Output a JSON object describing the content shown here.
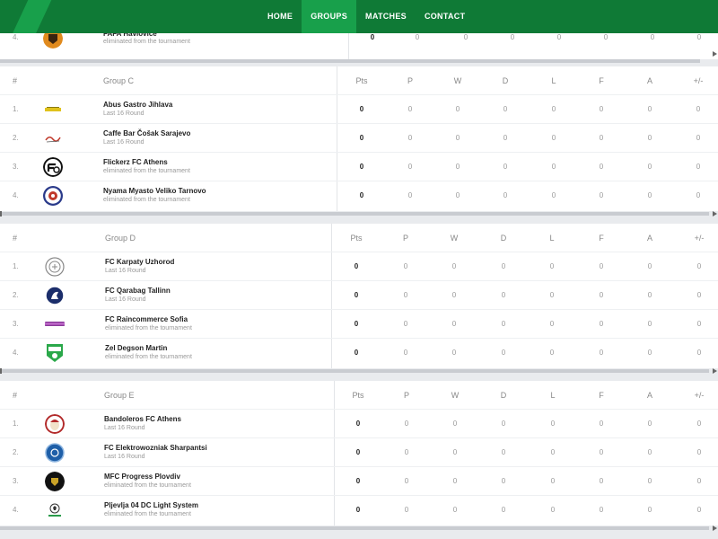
{
  "nav": {
    "home": "HOME",
    "groups": "GROUPS",
    "matches": "MATCHES",
    "contact": "CONTACT"
  },
  "columns": {
    "hash": "#",
    "pts": "Pts",
    "p": "P",
    "w": "W",
    "d": "D",
    "l": "L",
    "f": "F",
    "a": "A",
    "diff": "+/-"
  },
  "group_b_tail": {
    "rank": "4.",
    "name": "FAFA Havlovice",
    "status": "eliminated from the tournament",
    "pts": "0",
    "p": "0",
    "w": "0",
    "d": "0",
    "l": "0",
    "f": "0",
    "a": "0",
    "diff": "0",
    "logo": "shield-badge-icon"
  },
  "groups": [
    {
      "title": "Group C",
      "teams": [
        {
          "rank": "1.",
          "name": "Abus Gastro Jihlava",
          "status": "Last 16 Round",
          "pts": "0",
          "p": "0",
          "w": "0",
          "d": "0",
          "l": "0",
          "f": "0",
          "a": "0",
          "diff": "0",
          "logo": "text-logo-icon"
        },
        {
          "rank": "2.",
          "name": "Caffe Bar Čošak Sarajevo",
          "status": "Last 16 Round",
          "pts": "0",
          "p": "0",
          "w": "0",
          "d": "0",
          "l": "0",
          "f": "0",
          "a": "0",
          "diff": "0",
          "logo": "script-logo-icon"
        },
        {
          "rank": "3.",
          "name": "Flickerz FC Athens",
          "status": "eliminated from the tournament",
          "pts": "0",
          "p": "0",
          "w": "0",
          "d": "0",
          "l": "0",
          "f": "0",
          "a": "0",
          "diff": "0",
          "logo": "fc-ball-icon"
        },
        {
          "rank": "4.",
          "name": "Nyama Myasto Veliko Tarnovo",
          "status": "eliminated from the tournament",
          "pts": "0",
          "p": "0",
          "w": "0",
          "d": "0",
          "l": "0",
          "f": "0",
          "a": "0",
          "diff": "0",
          "logo": "round-crest-icon"
        }
      ]
    },
    {
      "title": "Group D",
      "teams": [
        {
          "rank": "1.",
          "name": "FC Karpaty Uzhorod",
          "status": "Last 16 Round",
          "pts": "0",
          "p": "0",
          "w": "0",
          "d": "0",
          "l": "0",
          "f": "0",
          "a": "0",
          "diff": "0",
          "logo": "outline-crest-icon"
        },
        {
          "rank": "2.",
          "name": "FC Qarabag Tallinn",
          "status": "Last 16 Round",
          "pts": "0",
          "p": "0",
          "w": "0",
          "d": "0",
          "l": "0",
          "f": "0",
          "a": "0",
          "diff": "0",
          "logo": "horse-crest-icon"
        },
        {
          "rank": "3.",
          "name": "FC Raincommerce Sofia",
          "status": "eliminated from the tournament",
          "pts": "0",
          "p": "0",
          "w": "0",
          "d": "0",
          "l": "0",
          "f": "0",
          "a": "0",
          "diff": "0",
          "logo": "banner-logo-icon"
        },
        {
          "rank": "4.",
          "name": "Zel Degson Martin",
          "status": "eliminated from the tournament",
          "pts": "0",
          "p": "0",
          "w": "0",
          "d": "0",
          "l": "0",
          "f": "0",
          "a": "0",
          "diff": "0",
          "logo": "zel-shield-icon"
        }
      ]
    },
    {
      "title": "Group E",
      "teams": [
        {
          "rank": "1.",
          "name": "Bandoleros FC Athens",
          "status": "Last 16 Round",
          "pts": "0",
          "p": "0",
          "w": "0",
          "d": "0",
          "l": "0",
          "f": "0",
          "a": "0",
          "diff": "0",
          "logo": "mask-crest-icon"
        },
        {
          "rank": "2.",
          "name": "FC Elektrowozniak Sharpantsi",
          "status": "Last 16 Round",
          "pts": "0",
          "p": "0",
          "w": "0",
          "d": "0",
          "l": "0",
          "f": "0",
          "a": "0",
          "diff": "0",
          "logo": "blue-crest-icon"
        },
        {
          "rank": "3.",
          "name": "MFC Progress Plovdiv",
          "status": "eliminated from the tournament",
          "pts": "0",
          "p": "0",
          "w": "0",
          "d": "0",
          "l": "0",
          "f": "0",
          "a": "0",
          "diff": "0",
          "logo": "black-crest-icon"
        },
        {
          "rank": "4.",
          "name": "Pljevlja 04 DC Light System",
          "status": "eliminated from the tournament",
          "pts": "0",
          "p": "0",
          "w": "0",
          "d": "0",
          "l": "0",
          "f": "0",
          "a": "0",
          "diff": "0",
          "logo": "ball-logo-icon"
        }
      ]
    }
  ],
  "colors": {
    "nav_bg": "#0f7a36",
    "nav_active": "#18a04b",
    "page_bg": "#e9ebee"
  }
}
